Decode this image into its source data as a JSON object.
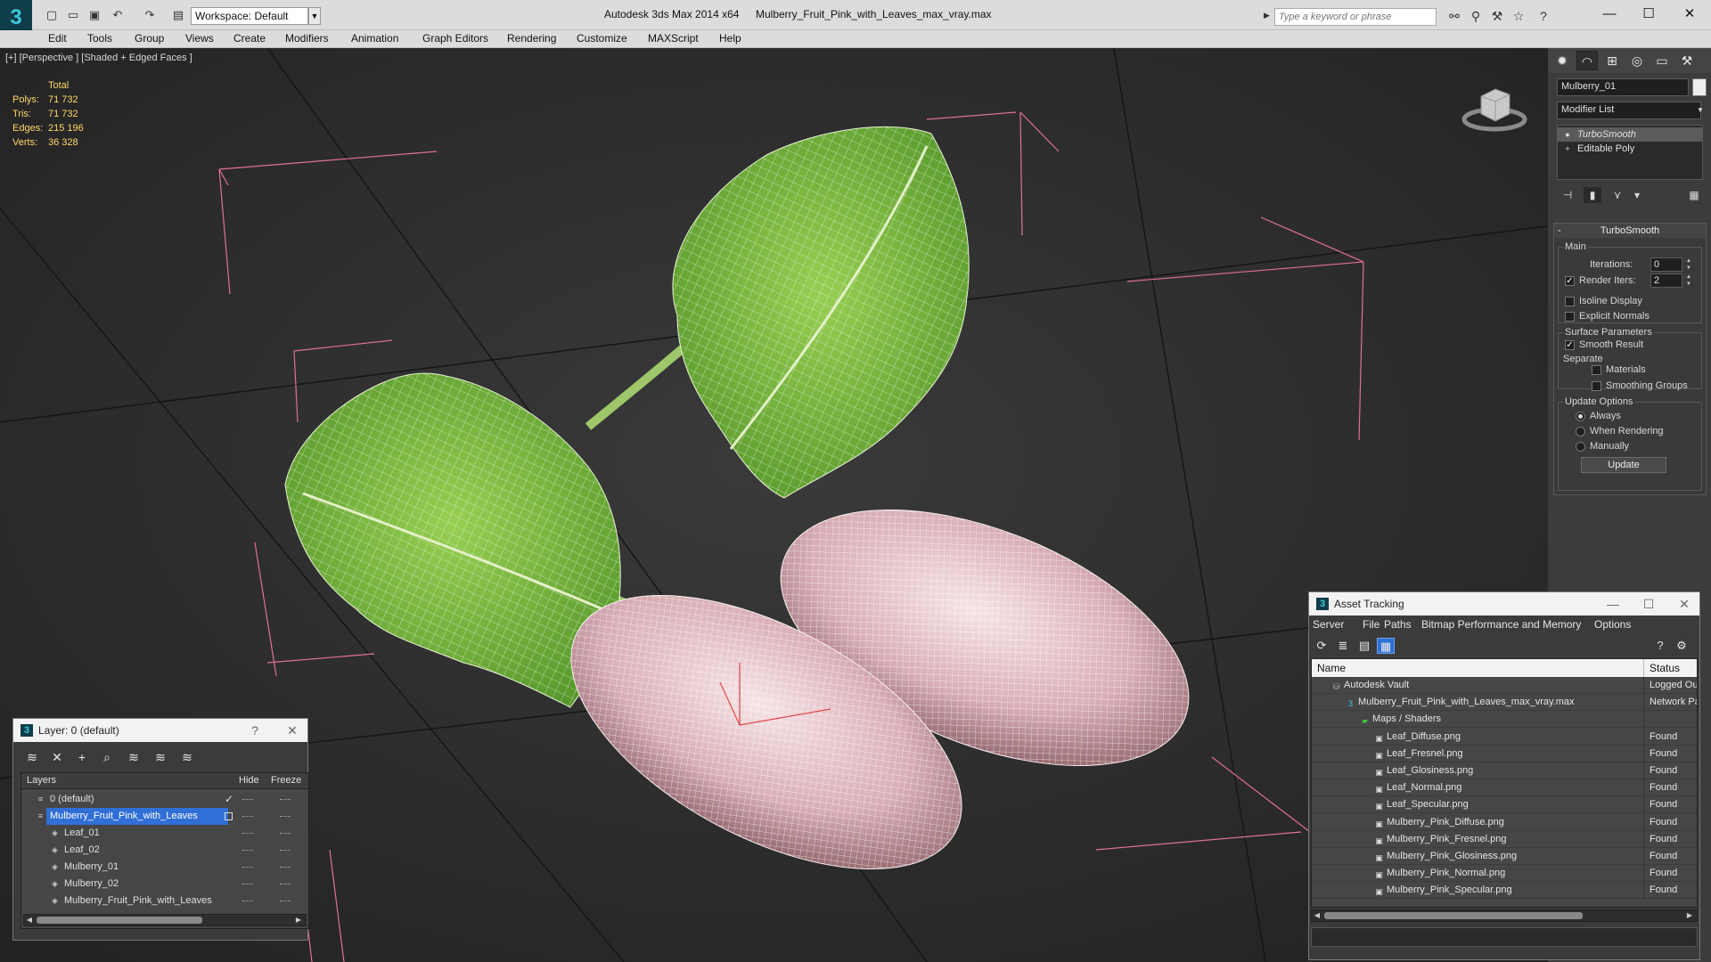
{
  "app": {
    "title": "Autodesk 3ds Max  2014 x64",
    "file": "Mulberry_Fruit_Pink_with_Leaves_max_vray.max",
    "workspace": "Workspace: Default",
    "search_placeholder": "Type a keyword or phrase"
  },
  "menu": [
    "Edit",
    "Tools",
    "Group",
    "Views",
    "Create",
    "Modifiers",
    "Animation",
    "Graph Editors",
    "Rendering",
    "Customize",
    "MAXScript",
    "Help"
  ],
  "viewport": {
    "label": "[+] [Perspective ] [Shaded + Edged Faces ]",
    "stats_header": "Total",
    "stats": [
      {
        "key": "Polys:",
        "value": "71 732"
      },
      {
        "key": "Tris:",
        "value": "71 732"
      },
      {
        "key": "Edges:",
        "value": "215 196"
      },
      {
        "key": "Verts:",
        "value": "36 328"
      }
    ]
  },
  "command_panel": {
    "object_name": "Mulberry_01",
    "modifier_list": "Modifier List",
    "stack": [
      "TurboSmooth",
      "Editable Poly"
    ],
    "rollout_title": "TurboSmooth",
    "main_label": "Main",
    "iterations_label": "Iterations:",
    "iterations_value": "0",
    "render_iters_label": "Render Iters:",
    "render_iters_value": "2",
    "render_iters_checked": true,
    "isoline_label": "Isoline Display",
    "explicit_normals_label": "Explicit Normals",
    "surface_params_label": "Surface Parameters",
    "smooth_result_label": "Smooth Result",
    "separate_label": "Separate",
    "materials_label": "Materials",
    "smoothing_groups_label": "Smoothing Groups",
    "update_options_label": "Update Options",
    "radio_always": "Always",
    "radio_when_rendering": "When Rendering",
    "radio_manually": "Manually",
    "update_button": "Update"
  },
  "layer_window": {
    "title": "Layer: 0 (default)",
    "help": "?",
    "col_layers": "Layers",
    "col_hide": "Hide",
    "col_freeze": "Freeze",
    "rows": [
      {
        "name": "0 (default)",
        "indent": 1,
        "icon": "layer",
        "check": "✓"
      },
      {
        "name": "Mulberry_Fruit_Pink_with_Leaves",
        "indent": 1,
        "icon": "layer",
        "selected": true
      },
      {
        "name": "Leaf_01",
        "indent": 2,
        "icon": "object"
      },
      {
        "name": "Leaf_02",
        "indent": 2,
        "icon": "object"
      },
      {
        "name": "Mulberry_01",
        "indent": 2,
        "icon": "object"
      },
      {
        "name": "Mulberry_02",
        "indent": 2,
        "icon": "object"
      },
      {
        "name": "Mulberry_Fruit_Pink_with_Leaves",
        "indent": 2,
        "icon": "object"
      }
    ]
  },
  "asset_tracking": {
    "title": "Asset Tracking",
    "menu": [
      "Server",
      "File",
      "Paths",
      "Bitmap Performance and Memory",
      "Options"
    ],
    "col_name": "Name",
    "col_status": "Status",
    "rows": [
      {
        "name": "Autodesk Vault",
        "level": 1,
        "status": "Logged Ou"
      },
      {
        "name": "Mulberry_Fruit_Pink_with_Leaves_max_vray.max",
        "level": 2,
        "status": "Network Pa"
      },
      {
        "name": "Maps / Shaders",
        "level": 3,
        "status": ""
      },
      {
        "name": "Leaf_Diffuse.png",
        "level": 4,
        "status": "Found"
      },
      {
        "name": "Leaf_Fresnel.png",
        "level": 4,
        "status": "Found"
      },
      {
        "name": "Leaf_Glosiness.png",
        "level": 4,
        "status": "Found"
      },
      {
        "name": "Leaf_Normal.png",
        "level": 4,
        "status": "Found"
      },
      {
        "name": "Leaf_Specular.png",
        "level": 4,
        "status": "Found"
      },
      {
        "name": "Mulberry_Pink_Diffuse.png",
        "level": 4,
        "status": "Found"
      },
      {
        "name": "Mulberry_Pink_Fresnel.png",
        "level": 4,
        "status": "Found"
      },
      {
        "name": "Mulberry_Pink_Glosiness.png",
        "level": 4,
        "status": "Found"
      },
      {
        "name": "Mulberry_Pink_Normal.png",
        "level": 4,
        "status": "Found"
      },
      {
        "name": "Mulberry_Pink_Specular.png",
        "level": 4,
        "status": "Found"
      }
    ]
  },
  "colors": {
    "selection": "#2f6fd6",
    "stats": "#ffd86a",
    "bbox": "#e0709a",
    "leaf": "#7fbf3a",
    "berry": "#e9c9cf"
  }
}
